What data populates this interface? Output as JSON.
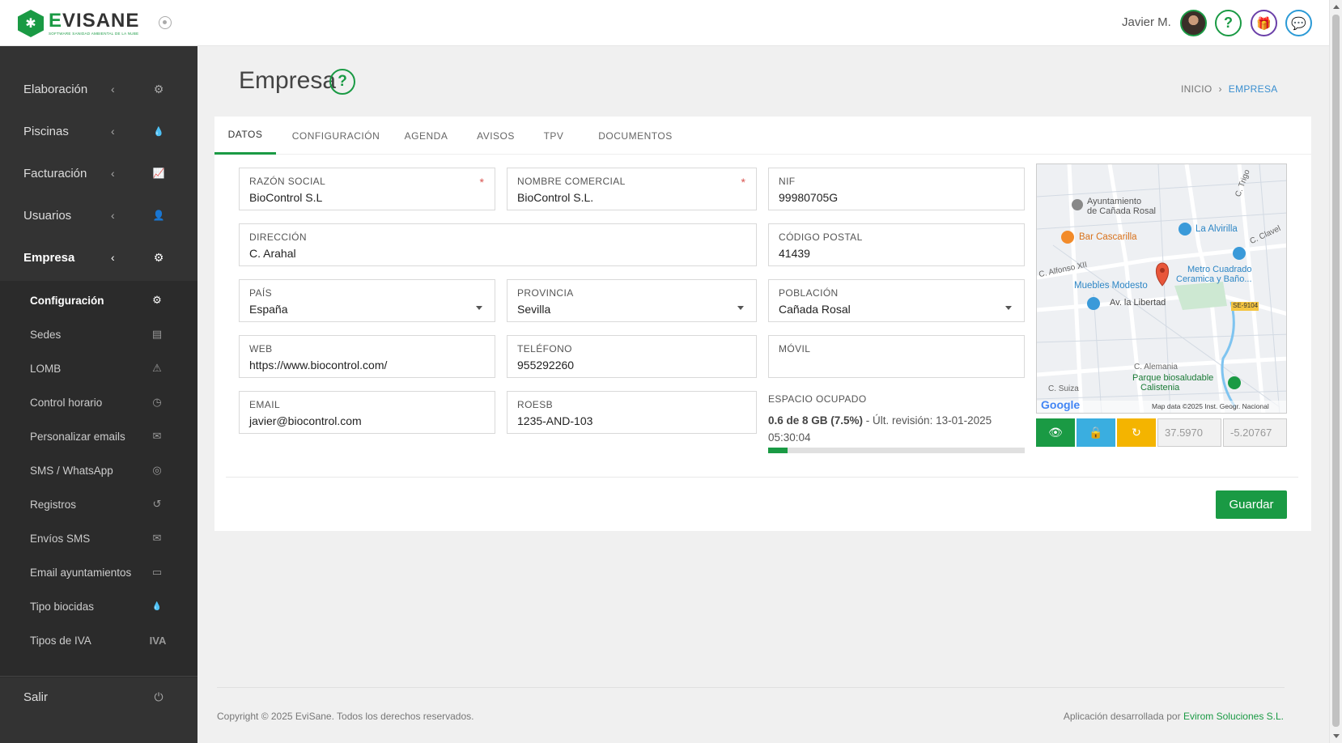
{
  "header": {
    "logo_name": "EVISANE",
    "logo_tagline": "SOFTWARE SANIDAD AMBIENTAL DE LA NUBE",
    "user_name": "Javier M.",
    "help_icon": "?",
    "gift_icon": "🎁",
    "chat_icon": "💬"
  },
  "sidebar": {
    "items": [
      {
        "label": "Elaboración",
        "icon": "⚙"
      },
      {
        "label": "Piscinas",
        "icon": "💧"
      },
      {
        "label": "Facturación",
        "icon": "📈"
      },
      {
        "label": "Usuarios",
        "icon": "👤"
      },
      {
        "label": "Empresa",
        "icon": "⚙"
      }
    ],
    "chevron": "‹",
    "subitems": [
      {
        "label": "Configuración",
        "icon": "⚙"
      },
      {
        "label": "Sedes",
        "icon": "▤"
      },
      {
        "label": "LOMB",
        "icon": "⚠"
      },
      {
        "label": "Control horario",
        "icon": "◷"
      },
      {
        "label": "Personalizar emails",
        "icon": "✉"
      },
      {
        "label": "SMS / WhatsApp",
        "icon": "◎"
      },
      {
        "label": "Registros",
        "icon": "↺"
      },
      {
        "label": "Envíos SMS",
        "icon": "✉"
      },
      {
        "label": "Email ayuntamientos",
        "icon": "▭"
      },
      {
        "label": "Tipo biocidas",
        "icon": "💧"
      },
      {
        "label": "Tipos de IVA",
        "icon": "IVA"
      }
    ],
    "logout": {
      "label": "Salir",
      "icon": "⏻"
    }
  },
  "page": {
    "title": "Empresa",
    "help": "?",
    "breadcrumb": {
      "home": "INICIO",
      "sep": "›",
      "current": "EMPRESA"
    }
  },
  "tabs": [
    "DATOS",
    "CONFIGURACIÓN",
    "AGENDA",
    "AVISOS",
    "TPV",
    "DOCUMENTOS"
  ],
  "form": {
    "razon_social": {
      "label": "RAZÓN SOCIAL",
      "value": "BioControl S.L",
      "required": "*"
    },
    "nombre_comercial": {
      "label": "NOMBRE COMERCIAL",
      "value": "BioControl S.L.",
      "required": "*"
    },
    "nif": {
      "label": "NIF",
      "value": "99980705G"
    },
    "direccion": {
      "label": "DIRECCIÓN",
      "value": "C. Arahal"
    },
    "codigo_postal": {
      "label": "CÓDIGO POSTAL",
      "value": "41439"
    },
    "pais": {
      "label": "PAÍS",
      "value": "España"
    },
    "provincia": {
      "label": "PROVINCIA",
      "value": "Sevilla"
    },
    "poblacion": {
      "label": "POBLACIÓN",
      "value": "Cañada Rosal"
    },
    "web": {
      "label": "WEB",
      "value": "https://www.biocontrol.com/"
    },
    "telefono": {
      "label": "TELÉFONO",
      "value": "955292260"
    },
    "movil": {
      "label": "MÓVIL",
      "value": ""
    },
    "email": {
      "label": "EMAIL",
      "value": "javier@biocontrol.com"
    },
    "roesb": {
      "label": "ROESB",
      "value": "1235-AND-103"
    }
  },
  "storage": {
    "label": "ESPACIO OCUPADO",
    "used": "0.6 de 8 GB (7.5%)",
    "revision": " - Últ. revisión: 13-01-2025 05:30:04",
    "fraction": 0.075
  },
  "map": {
    "labels": {
      "ayuntamiento": "Ayuntamiento de Cañada Rosal",
      "ayuntamiento_1": "Ayuntamiento",
      "ayuntamiento_2": "de Cañada Rosal",
      "bar": "Bar Cascarilla",
      "alvirilla": "La Alvirilla",
      "metro_1": "Metro Cuadrado",
      "metro_2": "Ceramica y Baño...",
      "muebles": "Muebles Modesto",
      "libertad": "Av. la Libertad",
      "alfonso": "C. Alfonso XII",
      "clavel": "C. Clavel",
      "trigo": "C. Trigo",
      "alemania": "C. Alemania",
      "parque_1": "Parque biosaludable",
      "parque_2": "Calistenia",
      "suiza": "C. Suiza",
      "road": "SE-9104",
      "google": "Google",
      "attribution": "Map data ©2025 Inst. Geogr. Nacional"
    },
    "lat": "37.5970",
    "lng": "-5.20767",
    "colors": {
      "view": "#1a9a44",
      "lock": "#3aaee0",
      "refresh": "#f4b400"
    }
  },
  "actions": {
    "save": "Guardar"
  },
  "footer": {
    "copyright": "Copyright © 2025 EviSane. Todos los derechos reservados.",
    "credit_prefix": "Aplicación desarrollada por ",
    "credit_company": "Evirom Soluciones S.L."
  }
}
